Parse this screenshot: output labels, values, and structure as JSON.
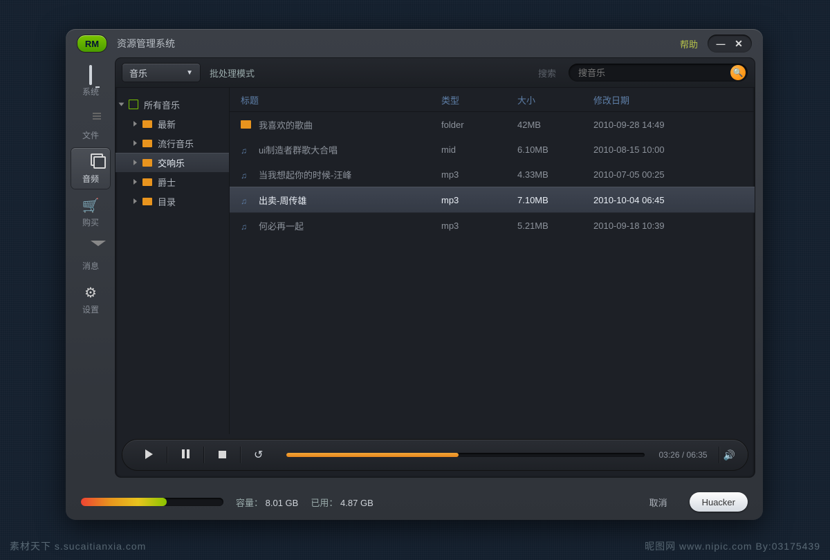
{
  "watermark": {
    "left": "素材天下 s.sucaitianxia.com",
    "right": "昵图网 www.nipic.com  By:03175439"
  },
  "window": {
    "logo": "RM",
    "title": "资源管理系统",
    "help": "帮助"
  },
  "sidebar": {
    "items": [
      {
        "label": "系统",
        "icon": "monitor"
      },
      {
        "label": "文件",
        "icon": "file"
      },
      {
        "label": "音频",
        "icon": "audio",
        "active": true
      },
      {
        "label": "购买",
        "icon": "cart"
      },
      {
        "label": "消息",
        "icon": "mail"
      },
      {
        "label": "设置",
        "icon": "gear"
      }
    ]
  },
  "toolbar": {
    "dropdown": "音乐",
    "batchmode": "批处理模式",
    "searchlabel": "搜索",
    "searchplaceholder": "搜音乐"
  },
  "tree": {
    "root": "所有音乐",
    "children": [
      "最新",
      "流行音乐",
      "交响乐",
      "爵士",
      "目录"
    ],
    "selected": "交响乐"
  },
  "table": {
    "headers": {
      "title": "标题",
      "type": "类型",
      "size": "大小",
      "date": "修改日期"
    },
    "rows": [
      {
        "icon": "folder",
        "title": "我喜欢的歌曲",
        "type": "folder",
        "size": "42MB",
        "date": "2010-09-28  14:49"
      },
      {
        "icon": "note",
        "title": "ui制造者群歌大合唱",
        "type": "mid",
        "size": "6.10MB",
        "date": "2010-08-15  10:00"
      },
      {
        "icon": "note",
        "title": "当我想起你的时候-汪峰",
        "type": "mp3",
        "size": "4.33MB",
        "date": "2010-07-05  00:25"
      },
      {
        "icon": "note",
        "title": "出卖-周传雄",
        "type": "mp3",
        "size": "7.10MB",
        "date": "2010-10-04  06:45",
        "selected": true
      },
      {
        "icon": "note",
        "title": "何必再一起",
        "type": "mp3",
        "size": "5.21MB",
        "date": "2010-09-18  10:39"
      }
    ]
  },
  "player": {
    "elapsed": "03:26",
    "total": "06:35",
    "progress_pct": 48
  },
  "footer": {
    "capacity_label": "容量：",
    "capacity_value": "8.01 GB",
    "used_label": "已用：",
    "used_value": "4.87 GB",
    "used_pct": 60,
    "cancel": "取消",
    "user": "Huacker"
  }
}
